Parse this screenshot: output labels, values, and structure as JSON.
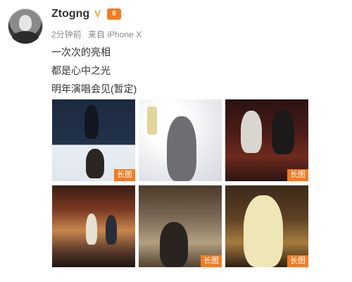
{
  "post": {
    "username": "Ztogng",
    "verified_glyph": "V",
    "vip_glyph": "6",
    "time": "2分钟前",
    "source": "来自 iPhone X",
    "lines": [
      "一次次的亮相",
      "都是心中之光",
      "明年演唱会见(暂定)"
    ]
  },
  "images": [
    {
      "badge": "长图",
      "icon": "long-image-photo"
    },
    {
      "badge": "",
      "icon": "photo"
    },
    {
      "badge": "长图",
      "icon": "long-image-photo"
    },
    {
      "badge": "",
      "icon": "photo"
    },
    {
      "badge": "长图",
      "icon": "long-image-photo"
    },
    {
      "badge": "长图",
      "icon": "long-image-photo"
    }
  ],
  "colors": {
    "badge": "#f57b20",
    "text": "#333333",
    "meta": "#8a8a8a",
    "verified": "#f5a623"
  }
}
